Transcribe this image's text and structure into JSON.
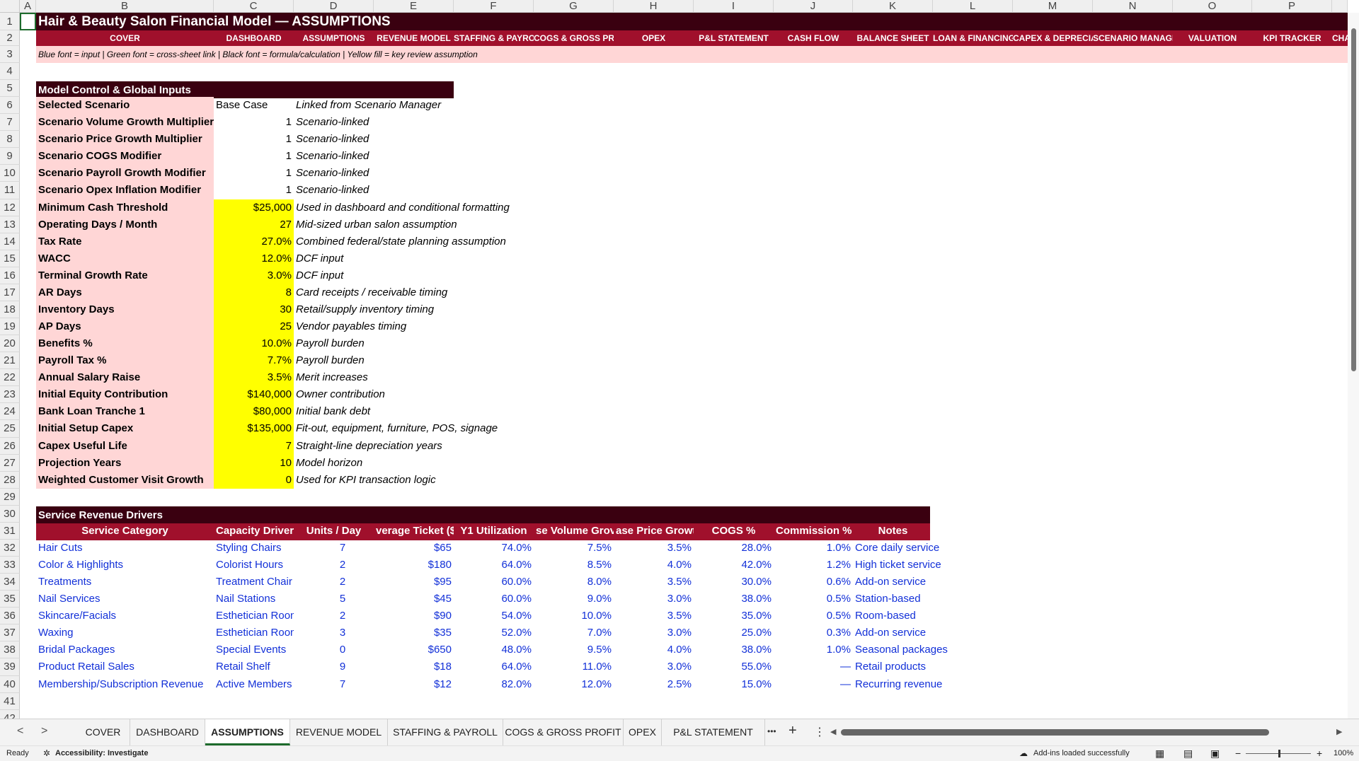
{
  "columns": [
    "A",
    "B",
    "C",
    "D",
    "E",
    "F",
    "G",
    "H",
    "I",
    "J",
    "K",
    "L",
    "M",
    "N",
    "O",
    "P"
  ],
  "rows": [
    "1",
    "2",
    "3",
    "4",
    "5",
    "6",
    "7",
    "8",
    "9",
    "10",
    "11",
    "12",
    "13",
    "14",
    "15",
    "16",
    "17",
    "18",
    "19",
    "20",
    "21",
    "22",
    "23",
    "24",
    "25",
    "26",
    "27",
    "28",
    "29",
    "30",
    "31",
    "32",
    "33",
    "34",
    "35",
    "36",
    "37",
    "38",
    "39",
    "40",
    "41",
    "42"
  ],
  "title": "Hair & Beauty Salon Financial Model — ASSUMPTIONS",
  "nav": [
    "COVER",
    "DASHBOARD",
    "ASSUMPTIONS",
    "REVENUE MODEL",
    "STAFFING & PAYROLL",
    "COGS & GROSS PROF",
    "OPEX",
    "P&L STATEMENT",
    "CASH FLOW",
    "BALANCE SHEET",
    "LOAN & FINANCING",
    "CAPEX & DEPRECIATI",
    "SCENARIO MANAGEF",
    "VALUATION",
    "KPI TRACKER",
    "CHA"
  ],
  "legend": "Blue font = input | Green font = cross-sheet link | Black font = formula/calculation | Yellow fill = key review assumption",
  "control": {
    "header": "Model Control & Global Inputs",
    "rows": [
      {
        "label": "Selected Scenario",
        "value": "Base Case",
        "note": "Linked from Scenario Manager"
      },
      {
        "label": "Scenario Volume Growth Multiplier",
        "value": "1",
        "note": "Scenario-linked"
      },
      {
        "label": "Scenario Price Growth Multiplier",
        "value": "1",
        "note": "Scenario-linked"
      },
      {
        "label": "Scenario COGS Modifier",
        "value": "1",
        "note": "Scenario-linked"
      },
      {
        "label": "Scenario Payroll Growth Modifier",
        "value": "1",
        "note": "Scenario-linked"
      },
      {
        "label": "Scenario Opex Inflation Modifier",
        "value": "1",
        "note": "Scenario-linked"
      },
      {
        "label": "Minimum Cash Threshold",
        "value": "$25,000",
        "note": "Used in dashboard and conditional formatting"
      },
      {
        "label": "Operating Days / Month",
        "value": "27",
        "note": "Mid-sized urban salon assumption"
      },
      {
        "label": "Tax Rate",
        "value": "27.0%",
        "note": "Combined federal/state planning assumption"
      },
      {
        "label": "WACC",
        "value": "12.0%",
        "note": "DCF input"
      },
      {
        "label": "Terminal Growth Rate",
        "value": "3.0%",
        "note": "DCF input"
      },
      {
        "label": "AR Days",
        "value": "8",
        "note": "Card receipts / receivable timing"
      },
      {
        "label": "Inventory Days",
        "value": "30",
        "note": "Retail/supply inventory timing"
      },
      {
        "label": "AP Days",
        "value": "25",
        "note": "Vendor payables timing"
      },
      {
        "label": "Benefits %",
        "value": "10.0%",
        "note": "Payroll burden"
      },
      {
        "label": "Payroll Tax %",
        "value": "7.7%",
        "note": "Payroll burden"
      },
      {
        "label": "Annual Salary Raise",
        "value": "3.5%",
        "note": "Merit increases"
      },
      {
        "label": "Initial Equity Contribution",
        "value": "$140,000",
        "note": "Owner contribution"
      },
      {
        "label": "Bank Loan Tranche 1",
        "value": "$80,000",
        "note": "Initial bank debt"
      },
      {
        "label": "Initial Setup Capex",
        "value": "$135,000",
        "note": "Fit-out, equipment, furniture, POS, signage"
      },
      {
        "label": "Capex Useful Life",
        "value": "7",
        "note": "Straight-line depreciation years"
      },
      {
        "label": "Projection Years",
        "value": "10",
        "note": "Model horizon"
      },
      {
        "label": "Weighted Customer Visit Growth",
        "value": "0",
        "note": "Used for KPI transaction logic"
      }
    ]
  },
  "service": {
    "header": "Service Revenue Drivers",
    "columns": [
      "Service Category",
      "Capacity Driver",
      "Units / Day",
      "verage Ticket ($",
      "Y1 Utilization",
      "se Volume Grov",
      "ase Price Growt",
      "COGS %",
      "Commission %",
      "Notes"
    ],
    "rows": [
      [
        "Hair Cuts",
        "Styling Chairs",
        "7",
        "$65",
        "74.0%",
        "7.5%",
        "3.5%",
        "28.0%",
        "1.0%",
        "Core daily service"
      ],
      [
        "Color & Highlights",
        "Colorist Hours",
        "2",
        "$180",
        "64.0%",
        "8.5%",
        "4.0%",
        "42.0%",
        "1.2%",
        "High ticket service"
      ],
      [
        "Treatments",
        "Treatment Chair",
        "2",
        "$95",
        "60.0%",
        "8.0%",
        "3.5%",
        "30.0%",
        "0.6%",
        "Add-on service"
      ],
      [
        "Nail Services",
        "Nail Stations",
        "5",
        "$45",
        "60.0%",
        "9.0%",
        "3.0%",
        "38.0%",
        "0.5%",
        "Station-based"
      ],
      [
        "Skincare/Facials",
        "Esthetician Roon",
        "2",
        "$90",
        "54.0%",
        "10.0%",
        "3.5%",
        "35.0%",
        "0.5%",
        "Room-based"
      ],
      [
        "Waxing",
        "Esthetician Roon",
        "3",
        "$35",
        "52.0%",
        "7.0%",
        "3.0%",
        "25.0%",
        "0.3%",
        "Add-on service"
      ],
      [
        "Bridal Packages",
        "Special Events",
        "0",
        "$650",
        "48.0%",
        "9.5%",
        "4.0%",
        "38.0%",
        "1.0%",
        "Seasonal packages"
      ],
      [
        "Product Retail Sales",
        "Retail Shelf",
        "9",
        "$18",
        "64.0%",
        "11.0%",
        "3.0%",
        "55.0%",
        "—",
        "Retail products"
      ],
      [
        "Membership/Subscription Revenue",
        "Active Members",
        "7",
        "$12",
        "82.0%",
        "12.0%",
        "2.5%",
        "15.0%",
        "—",
        "Recurring revenue"
      ]
    ]
  },
  "tabs": [
    "COVER",
    "DASHBOARD",
    "ASSUMPTIONS",
    "REVENUE MODEL",
    "STAFFING & PAYROLL",
    "COGS & GROSS PROFIT",
    "OPEX",
    "P&L STATEMENT"
  ],
  "active_tab": "ASSUMPTIONS",
  "tab_controls": {
    "more": "•••",
    "add": "+",
    "menu": "⋮",
    "prev": "◀",
    "next": "▶",
    "left": "<",
    "right": ">"
  },
  "status": {
    "ready": "Ready",
    "accessibility": "Accessibility: Investigate",
    "addins": "Add-ins loaded successfully",
    "zoom": "100%",
    "zoom_out": "−",
    "zoom_in": "+"
  },
  "colors": {
    "dark_header": "#3a0010",
    "nav_bar": "#a0102c",
    "pink_fill": "#ffd6d6",
    "yellow_fill": "#ffff00",
    "input_blue": "#1230d8"
  }
}
